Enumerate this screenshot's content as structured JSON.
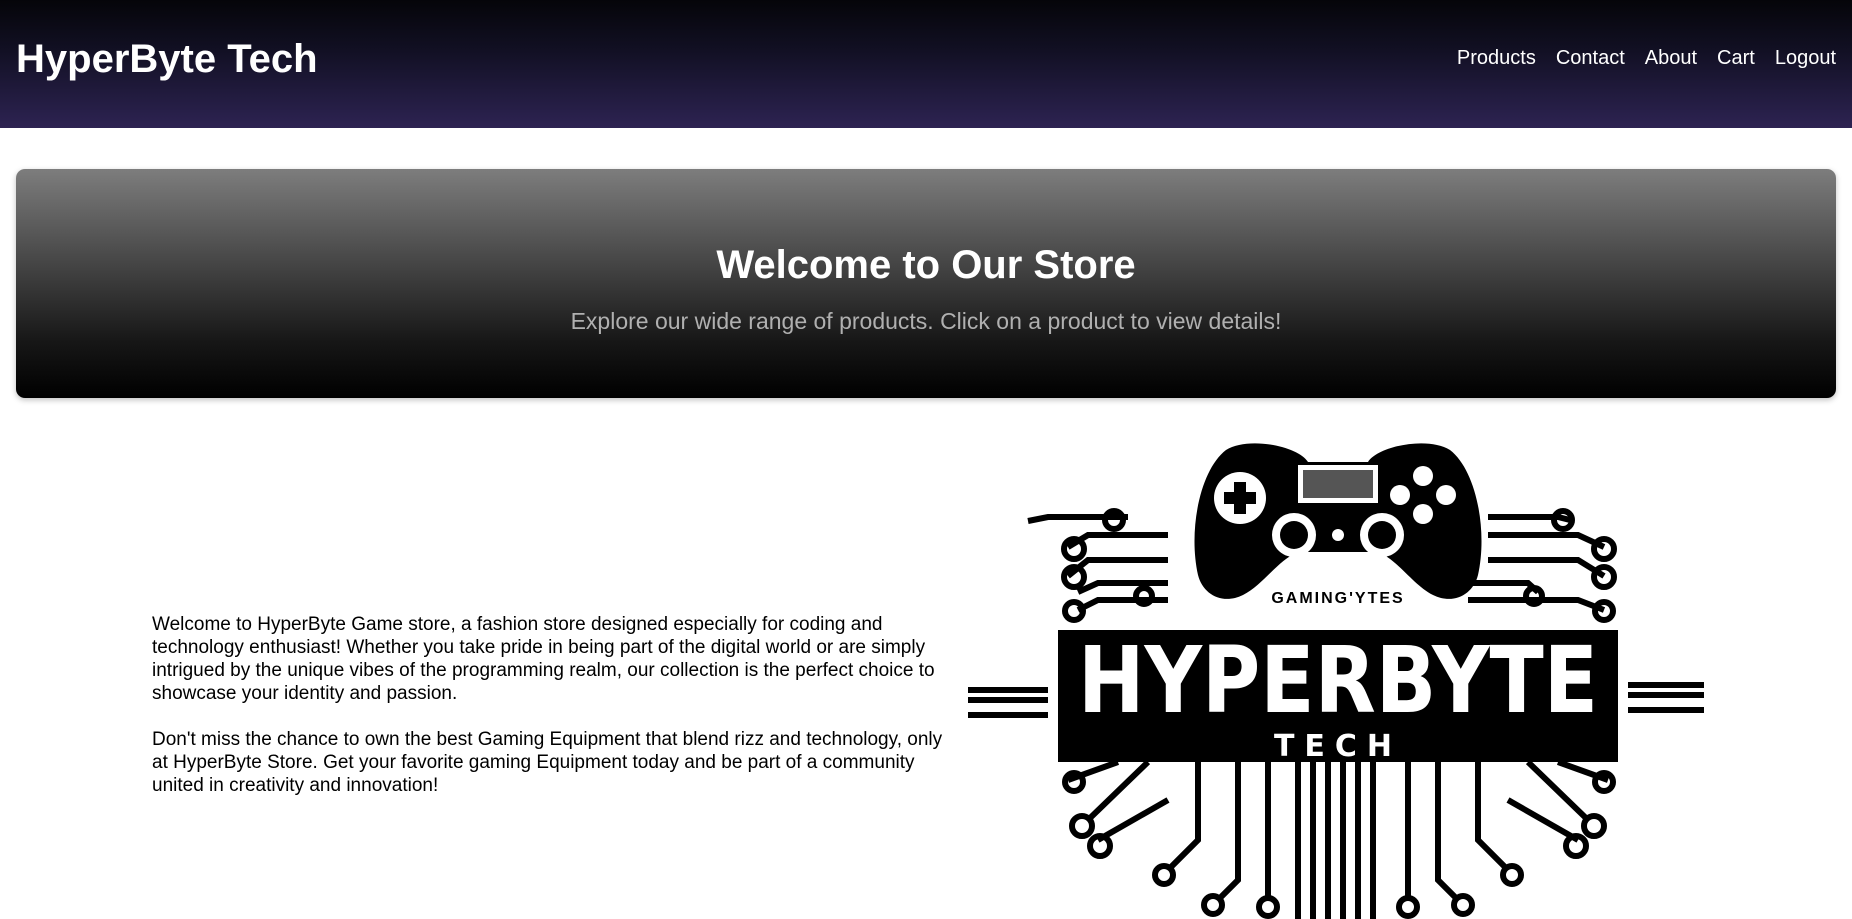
{
  "header": {
    "brand": "HyperByte Tech",
    "nav": [
      "Products",
      "Contact",
      "About",
      "Cart",
      "Logout"
    ]
  },
  "hero": {
    "title": "Welcome to Our Store",
    "subtitle": "Explore our wide range of products. Click on a product to view details!"
  },
  "about": {
    "paragraphs": [
      "Welcome to HyperByte Game store, a fashion store designed especially for coding and technology enthusiast! Whether you take pride in being part of the digital world or are simply intrigued by the unique vibes of the programming realm, our collection is the perfect choice to showcase your identity and passion.",
      "Don't miss the chance to own the best Gaming Equipment that blend rizz and technology, only at HyperByte Store. Get your favorite gaming Equipment today and be part of a community united in creativity and innovation!"
    ]
  },
  "logo": {
    "tagline": "GAMING'YTES",
    "wordmark": "HYPERBYTE",
    "subword": "TECH",
    "icon": "gamepad-circuit-icon"
  },
  "colors": {
    "header_top": "#050509",
    "header_bottom": "#2d2352",
    "hero_top": "#7d7d7d",
    "hero_bottom": "#000000",
    "hero_subtitle": "#b0b0b0"
  }
}
